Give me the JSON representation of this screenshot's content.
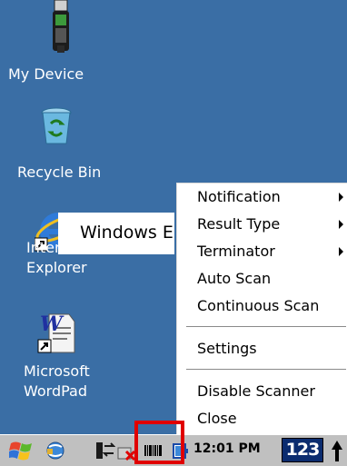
{
  "desktop": {
    "icons": [
      {
        "label": "My Device",
        "icon": "device-icon"
      },
      {
        "label": "Recycle Bin",
        "icon": "recycle-bin-icon"
      },
      {
        "label_line1": "Internet",
        "label_line2": "Explorer",
        "icon": "internet-explorer-icon",
        "overlay_text": "Windows E"
      },
      {
        "label_line1": "Microsoft",
        "label_line2": "WordPad",
        "icon": "wordpad-icon"
      }
    ]
  },
  "menu": {
    "items": [
      {
        "label": "Notification",
        "submenu": true
      },
      {
        "label": "Result Type",
        "submenu": true
      },
      {
        "label": "Terminator",
        "submenu": true
      },
      {
        "label": "Auto Scan",
        "submenu": false
      },
      {
        "label": "Continuous Scan",
        "submenu": false
      },
      {
        "label": "Settings",
        "submenu": false
      },
      {
        "label": "Disable Scanner",
        "submenu": false
      },
      {
        "label": "Close",
        "submenu": false
      }
    ]
  },
  "taskbar": {
    "clock": "12:01 PM",
    "input_panel": "123",
    "icons": [
      "start-icon",
      "network-icon",
      "connection-icon",
      "disconnected-icon",
      "scanner-icon",
      "battery-icon",
      "up-arrow-icon"
    ]
  },
  "colors": {
    "desktop_bg": "#3a6ea5",
    "highlight": "#e00000",
    "taskbar_bg": "#c0c0c0"
  }
}
